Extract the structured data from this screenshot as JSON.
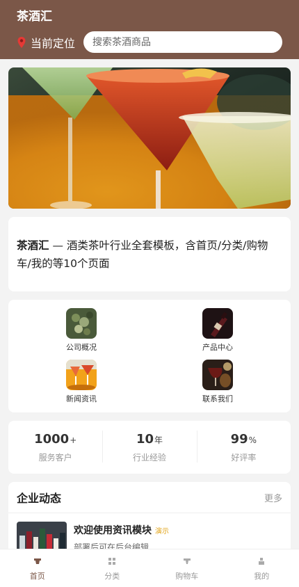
{
  "header": {
    "app_title": "茶酒汇",
    "location_label": "当前定位",
    "search_placeholder": "搜索茶酒商品"
  },
  "intro": {
    "brand": "茶酒汇",
    "text": " — 酒类茶叶行业全套模板，含首页/分类/购物车/我的等10个页面"
  },
  "grid": [
    {
      "label": "公司概况",
      "icon": "grape-vine-icon"
    },
    {
      "label": "产品中心",
      "icon": "wine-bottle-icon"
    },
    {
      "label": "新闻资讯",
      "icon": "cocktail-icon"
    },
    {
      "label": "联系我们",
      "icon": "wine-glass-icon"
    }
  ],
  "stats": [
    {
      "value": "1000",
      "unit": "+",
      "label": "服务客户"
    },
    {
      "value": "10",
      "unit": "年",
      "label": "行业经验"
    },
    {
      "value": "99",
      "unit": "%",
      "label": "好评率"
    }
  ],
  "news": {
    "title": "企业动态",
    "more": "更多",
    "items": [
      {
        "title": "欢迎使用资讯模块",
        "tag": "演示",
        "desc": "部署后可在后台编辑"
      }
    ]
  },
  "tabbar": [
    {
      "label": "首页",
      "icon": "home-icon",
      "active": true
    },
    {
      "label": "分类",
      "icon": "category-icon",
      "active": false
    },
    {
      "label": "购物车",
      "icon": "cart-icon",
      "active": false
    },
    {
      "label": "我的",
      "icon": "user-icon",
      "active": false
    }
  ],
  "colors": {
    "brand": "#7b5748",
    "tag": "#e2a419",
    "background": "#f3f3f3"
  }
}
